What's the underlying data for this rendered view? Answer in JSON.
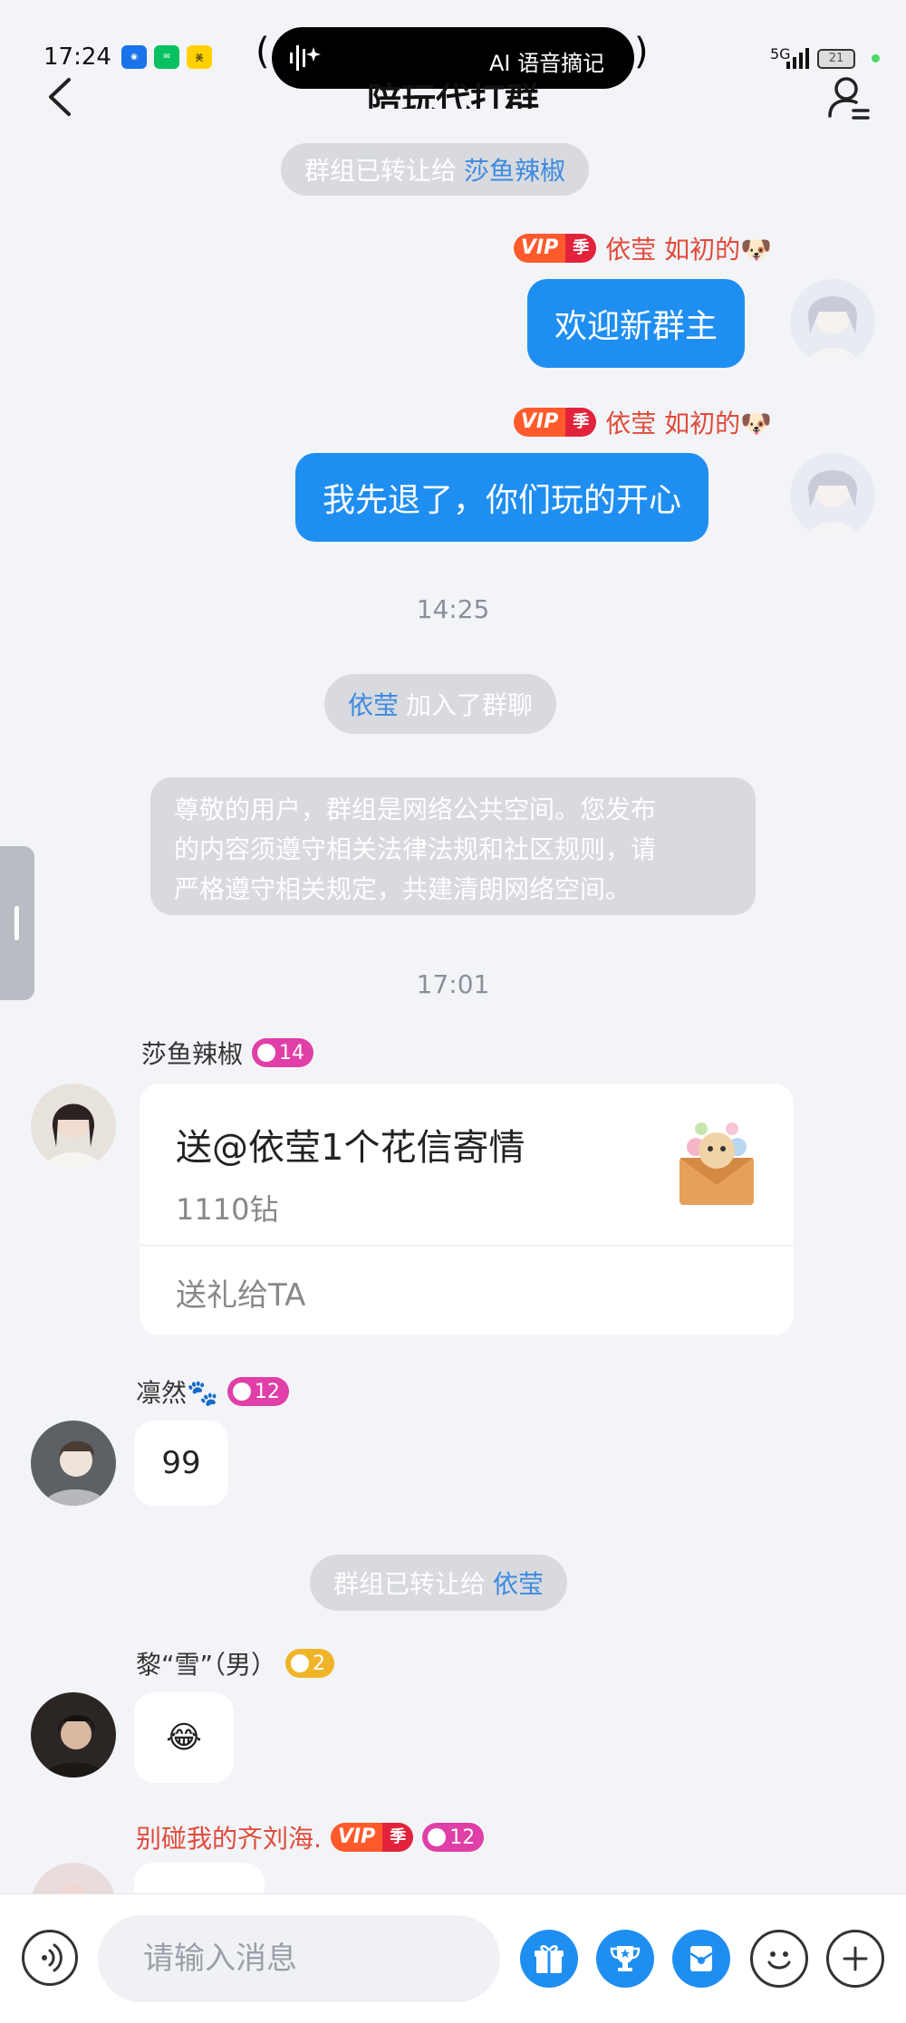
{
  "status_bar": {
    "time": "17:24",
    "island_text": "AI 语音摘记",
    "network": "5G",
    "battery": "21"
  },
  "header": {
    "title": "陪玩代打群"
  },
  "messages": {
    "sys_transfer_1": {
      "text": "群组已转让给",
      "name": "莎鱼辣椒"
    },
    "right_1": {
      "name": "依莹 如初的🐶",
      "vip": "VIP",
      "season": "季",
      "text": "欢迎新群主"
    },
    "right_2": {
      "name": "依莹 如初的🐶",
      "vip": "VIP",
      "season": "季",
      "text": "我先退了，你们玩的开心"
    },
    "time_1": "14:25",
    "sys_join": {
      "name": "依莹",
      "text": "加入了群聊"
    },
    "notice_lines": [
      "尊敬的用户，群组是网络公共空间。您发布",
      "的内容须遵守相关法律法规和社区规则，请",
      "严格遵守相关规定，共建清朗网络空间。"
    ],
    "time_2": "17:01",
    "left_1": {
      "name": "莎鱼辣椒",
      "level": "14",
      "gift_title": "送@依莹1个花信寄情",
      "gift_price": "1110钻",
      "gift_action": "送礼给TA"
    },
    "left_2": {
      "name": "凛然🐾",
      "level": "12",
      "text": "99"
    },
    "sys_transfer_2": {
      "text": "群组已转让给",
      "name": "依莹"
    },
    "left_3": {
      "name": "黎“雪”（男）",
      "level": "2",
      "text": "😂"
    },
    "left_4": {
      "name": "别碰我的齐刘海.",
      "vip": "VIP",
      "season": "季",
      "level": "12"
    }
  },
  "input": {
    "placeholder": "请输入消息"
  },
  "colors": {
    "accent_blue": "#1f8ef1",
    "vip_red": "#e14a3a",
    "level_pink": "#e03fa7",
    "level_gold": "#f0b429"
  }
}
